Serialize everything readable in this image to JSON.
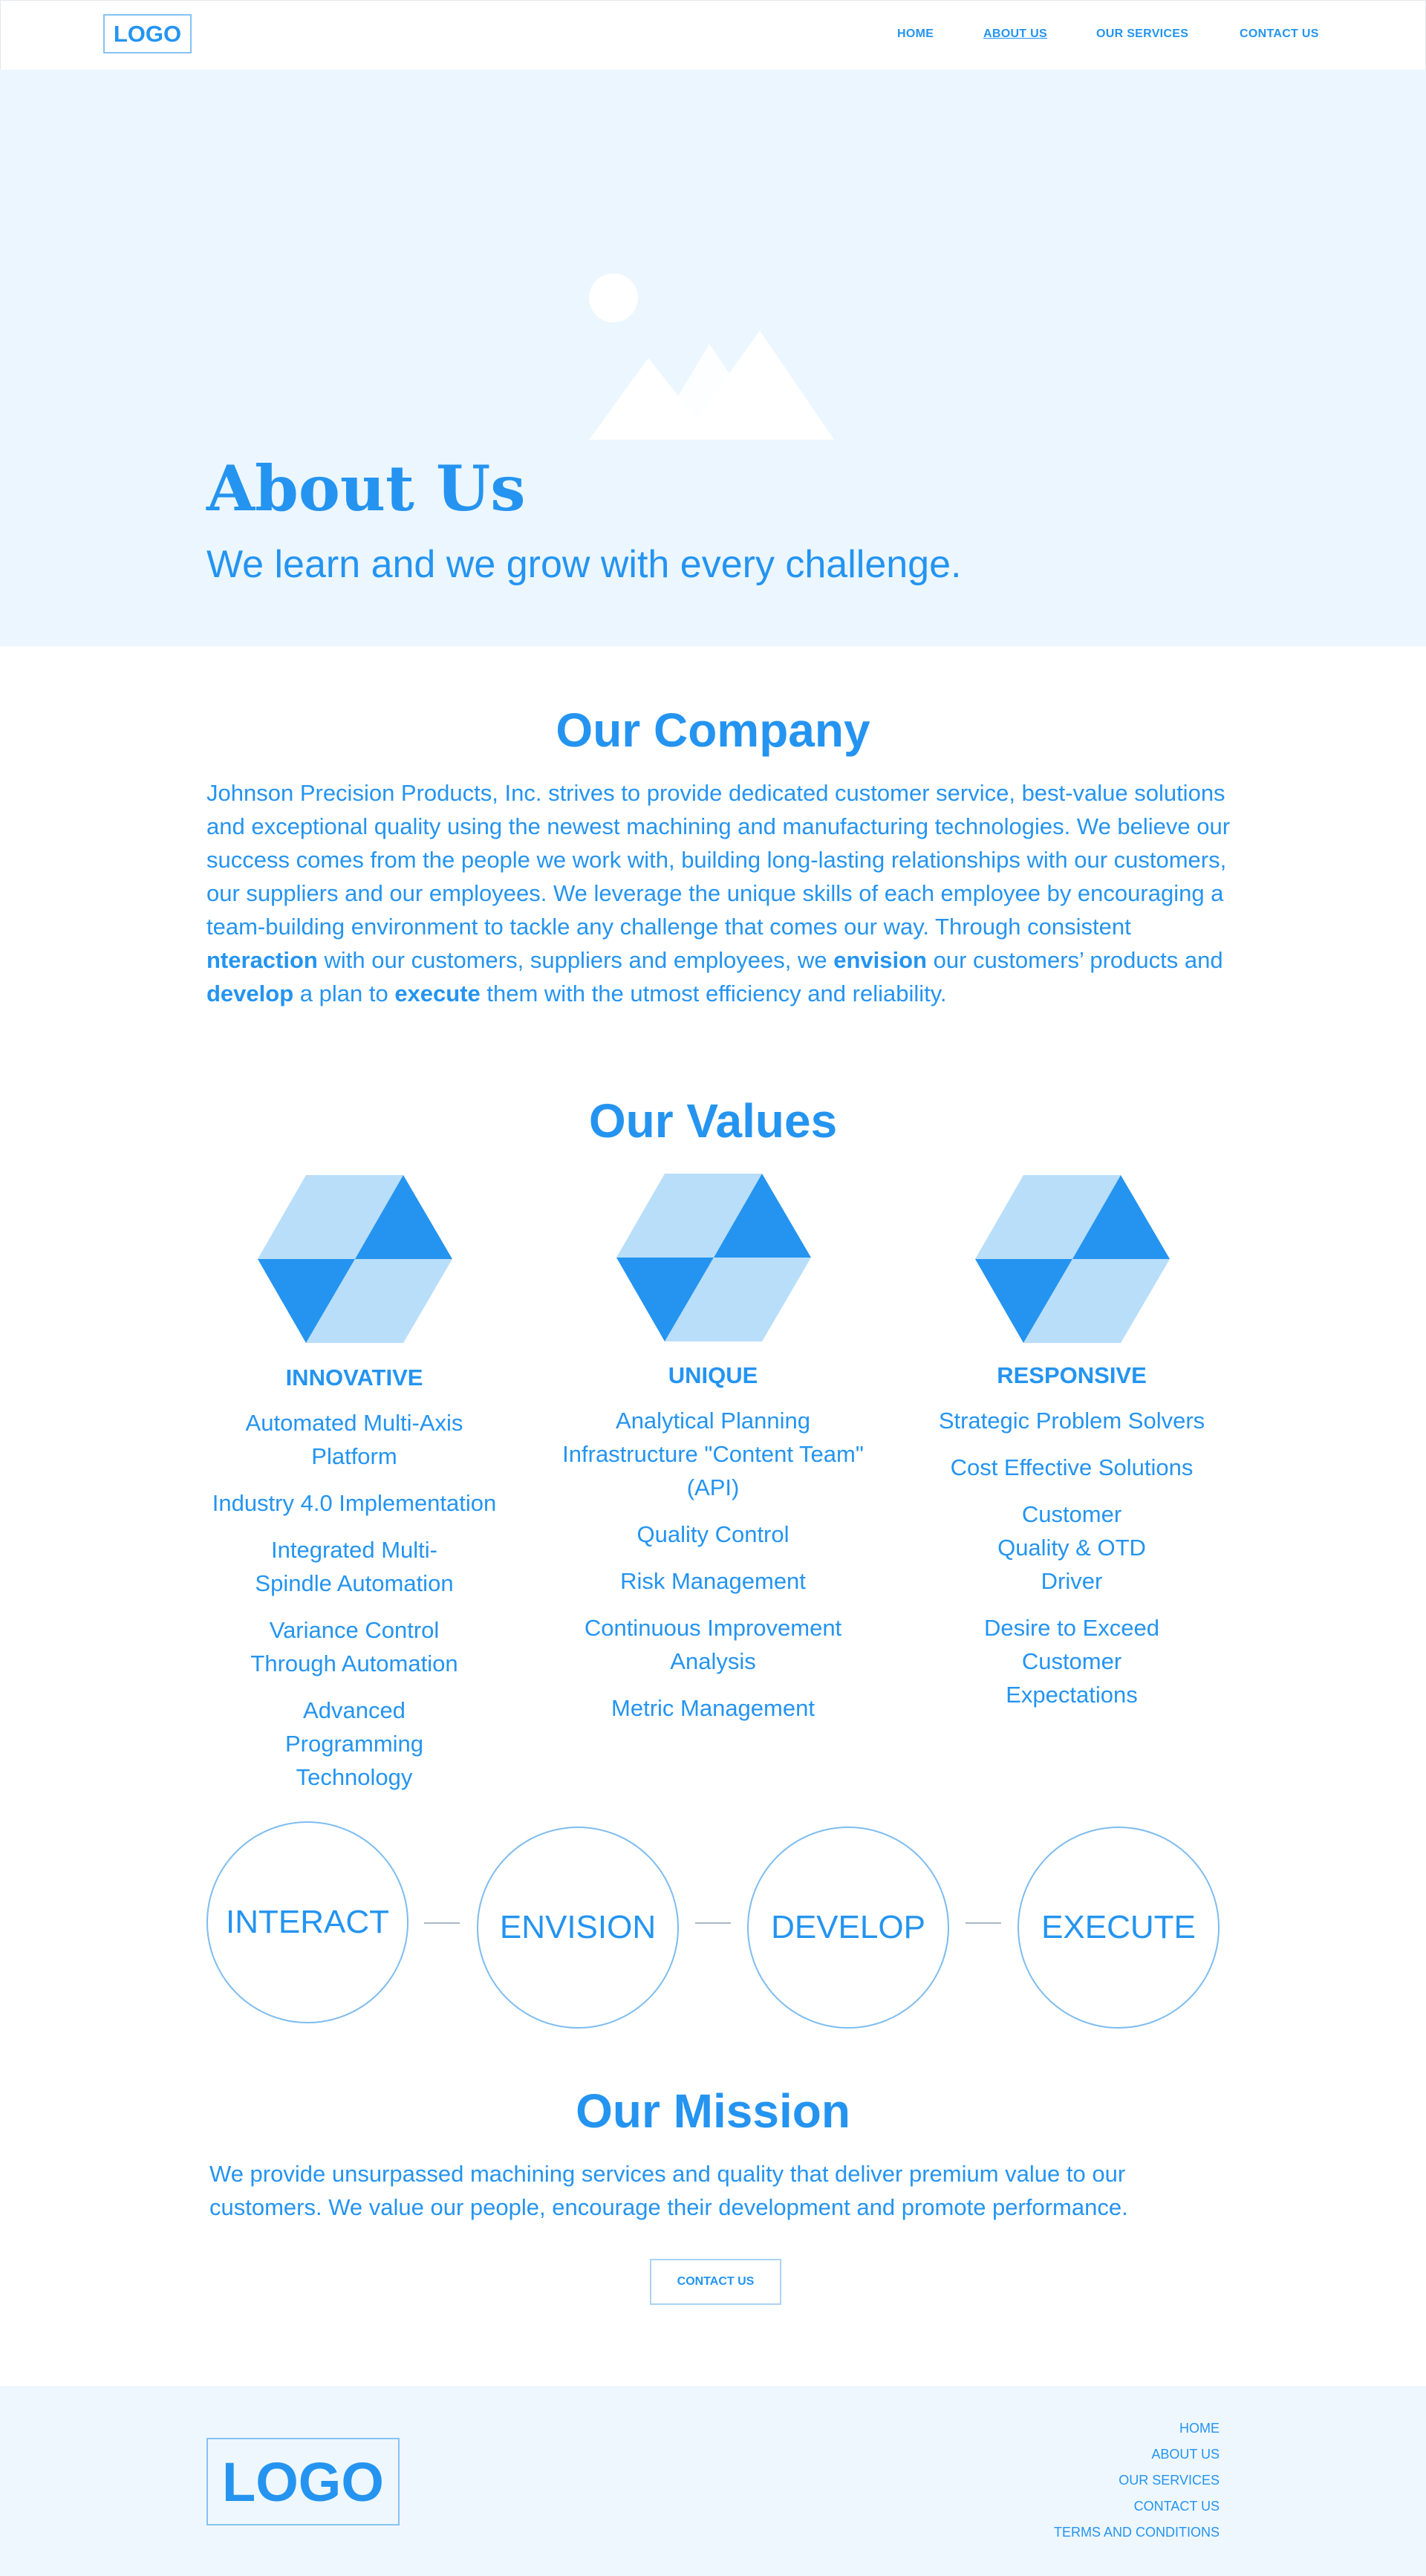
{
  "header": {
    "logo": "LOGO",
    "nav": [
      "HOME",
      "ABOUT US",
      "OUR SERVICES",
      "CONTACT US"
    ]
  },
  "hero": {
    "title": "About Us",
    "subtitle": "We learn and we grow with every challenge.",
    "image_icon": "image-placeholder-icon"
  },
  "company": {
    "title": "Our Company",
    "intro": "Johnson Precision Products, Inc. strives to provide dedicated customer service, best-value solutions and exceptional quality using the newest machining and manufacturing technologies. We believe our success comes from the people we work with, building long-lasting relationships with our customers, our suppliers and our employees. We leverage the unique skills of each employee by encouraging a team-building environment to tackle any challenge that comes our way. Through consistent ",
    "b1": "nteraction",
    "t1": " with our customers, suppliers and employees, we ",
    "b2": "envision",
    "t2": " our customers’ products and ",
    "b3": "develop",
    "t3": " a plan to ",
    "b4": "execute",
    "t4": " them with the utmost efficiency and reliability."
  },
  "values": {
    "title": "Our Values",
    "columns": [
      {
        "title": "INNOVATIVE",
        "items": [
          "Automated Multi-Axis Platform",
          "Industry 4.0 Implementation",
          "Integrated Multi-Spindle Automation",
          "Variance Control Through Automation",
          "Advanced Programming Technology"
        ]
      },
      {
        "title": "UNIQUE",
        "items": [
          "Analytical Planning Infrastructure \"Content Team\" (API)",
          "Quality Control",
          "Risk Management",
          "Continuous Improvement Analysis",
          "Metric Management"
        ]
      },
      {
        "title": "RESPONSIVE",
        "items": [
          "Strategic Problem Solvers",
          "Cost Effective Solutions",
          "Customer Quality & OTD Driver",
          "Desire to Exceed Customer Expectations"
        ]
      }
    ],
    "colors": {
      "light": "#b9defa",
      "dark": "#2494f0"
    }
  },
  "process": [
    "INTERACT",
    "ENVISION",
    "DEVELOP",
    "EXECUTE"
  ],
  "mission": {
    "title": "Our Mission",
    "text": "We provide unsurpassed machining services and quality that deliver premium value to our customers. We value our people, encourage their development and promote performance.",
    "button": "CONTACT US"
  },
  "footer": {
    "logo": "LOGO",
    "links": [
      "HOME",
      "ABOUT US",
      "OUR SERVICES",
      "CONTACT US",
      "TERMS AND CONDITIONS"
    ]
  },
  "colors": {
    "accent": "#2494f0",
    "hero_bg": "#ebf6ff",
    "footer_bg": "#eef7fe"
  }
}
